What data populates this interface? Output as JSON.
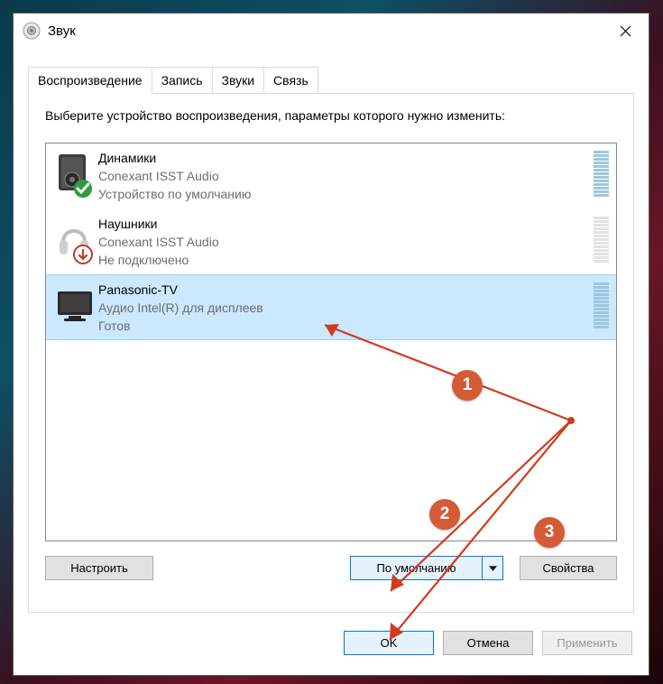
{
  "window": {
    "title": "Звук"
  },
  "tabs": [
    "Воспроизведение",
    "Запись",
    "Звуки",
    "Связь"
  ],
  "active_tab": 0,
  "instruction": "Выберите устройство воспроизведения, параметры которого нужно изменить:",
  "devices": [
    {
      "name": "Динамики",
      "device": "Conexant ISST Audio",
      "status": "Устройство по умолчанию",
      "badge": "default",
      "icon": "speaker",
      "selected": false,
      "meter": "on"
    },
    {
      "name": "Наушники",
      "device": "Conexant ISST Audio",
      "status": "Не подключено",
      "badge": "unplugged",
      "icon": "headphones",
      "selected": false,
      "meter": "off"
    },
    {
      "name": "Panasonic-TV",
      "device": "Аудио Intel(R) для дисплеев",
      "status": "Готов",
      "badge": null,
      "icon": "tv",
      "selected": true,
      "meter": "on"
    }
  ],
  "buttons": {
    "configure": "Настроить",
    "set_default": "По умолчанию",
    "properties": "Свойства",
    "ok": "OK",
    "cancel": "Отмена",
    "apply": "Применить"
  },
  "annotations": {
    "b1": "1",
    "b2": "2",
    "b3": "3"
  }
}
